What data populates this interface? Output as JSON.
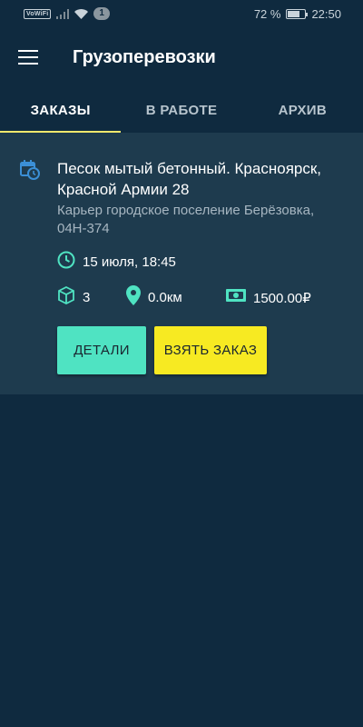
{
  "status_bar": {
    "vowifi": "VoWiFi",
    "notifications": "1",
    "battery": "72 %",
    "time": "22:50",
    "battery_level": 0.72
  },
  "app_bar": {
    "title": "Грузоперевозки",
    "menu_icon": "menu-icon"
  },
  "tabs": [
    {
      "label": "ЗАКАЗЫ",
      "active": true
    },
    {
      "label": "В РАБОТЕ",
      "active": false
    },
    {
      "label": "АРХИВ",
      "active": false
    }
  ],
  "order": {
    "title": "Песок мытый бетонный. Красноярск, Красной Армии 28",
    "subtitle": "Карьер городское поселение Берёзовка, 04Н-374",
    "datetime": "15 июля, 18:45",
    "quantity": "3",
    "distance": "0.0км",
    "price": "1500.00₽",
    "details_label": "ДЕТАЛИ",
    "take_label": "ВЗЯТЬ ЗАКАЗ"
  },
  "colors": {
    "background": "#0f2a3f",
    "card": "#1e3b4e",
    "accent_teal": "#4fe3c2",
    "accent_yellow": "#f7ea22",
    "icon_blue": "#3b8fd6",
    "icon_teal": "#4fe3c2"
  }
}
